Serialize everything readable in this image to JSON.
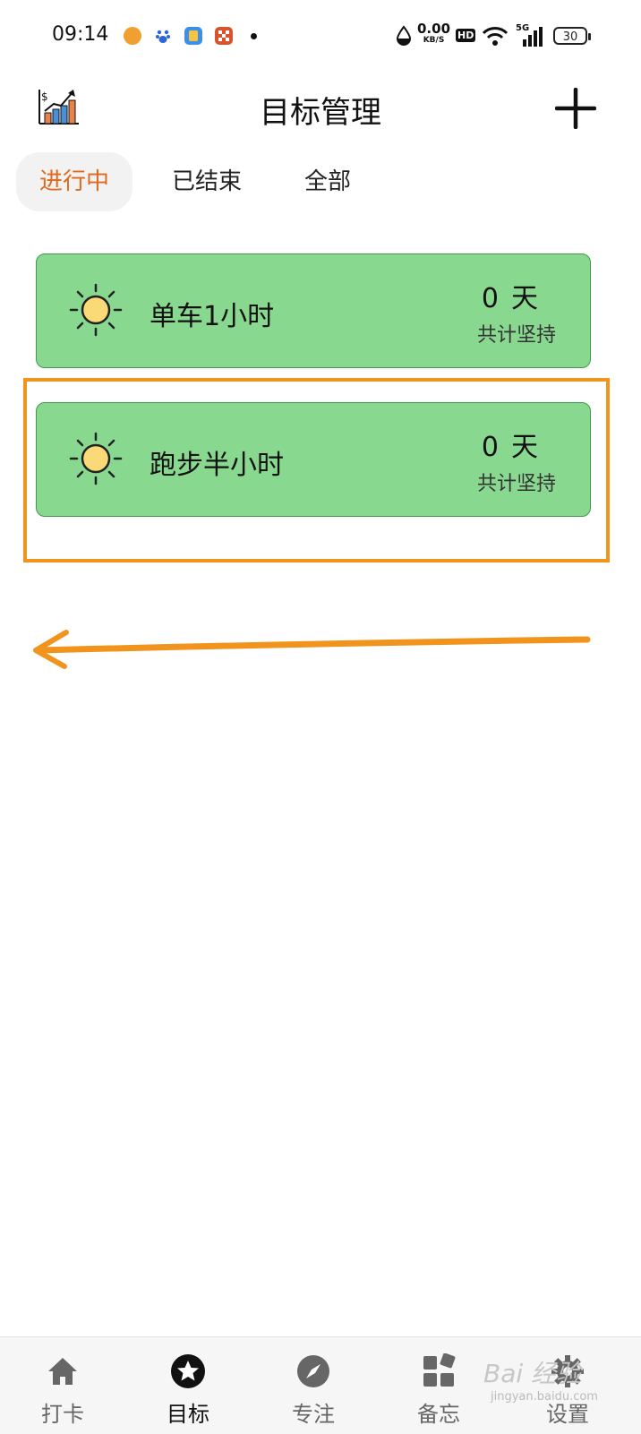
{
  "status_bar": {
    "time": "09:14",
    "net_speed": "0.00",
    "net_unit": "KB/S",
    "hd_label": "HD",
    "signal_label": "5G",
    "battery_level": "30",
    "icons": [
      "notif-app-1-icon",
      "notif-baidu-icon",
      "notif-app-3-icon",
      "notif-app-4-icon",
      "drop-icon",
      "wifi-icon",
      "signal-icon",
      "battery-icon"
    ]
  },
  "header": {
    "title": "目标管理",
    "logo_icon": "chart-growth-icon",
    "add_icon": "plus-icon"
  },
  "tabs": [
    {
      "label": "进行中",
      "active": true
    },
    {
      "label": "已结束",
      "active": false
    },
    {
      "label": "全部",
      "active": false
    }
  ],
  "goals": [
    {
      "icon": "sun-icon",
      "name": "单车1小时",
      "days": "0",
      "unit": "天",
      "caption": "共计坚持"
    },
    {
      "icon": "sun-icon",
      "name": "跑步半小时",
      "days": "0",
      "unit": "天",
      "caption": "共计坚持"
    }
  ],
  "bottom_nav": [
    {
      "label": "打卡",
      "icon": "home-icon",
      "active": false
    },
    {
      "label": "目标",
      "icon": "star-icon",
      "active": true
    },
    {
      "label": "专注",
      "icon": "compass-icon",
      "active": false
    },
    {
      "label": "备忘",
      "icon": "grid-icon",
      "active": false
    },
    {
      "label": "设置",
      "icon": "gear-icon",
      "active": false
    }
  ],
  "watermark": {
    "text": "Bai 经验",
    "sub": "jingyan.baidu.com"
  },
  "colors": {
    "accent": "#e06a1c",
    "card_fill": "#88d88f",
    "card_border": "#3f9a4a",
    "annotation": "#f0941d"
  }
}
